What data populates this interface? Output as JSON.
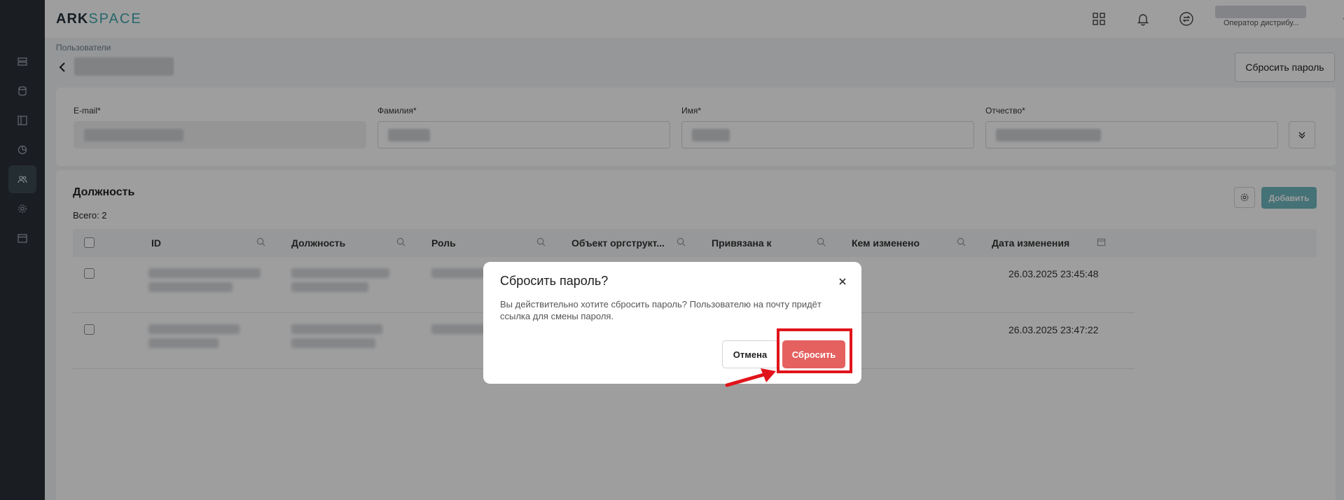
{
  "app": {
    "logo_part1": "ARK",
    "logo_part2": "SPACE"
  },
  "header": {
    "user_role": "Оператор дистрибу..."
  },
  "breadcrumb": "Пользователи",
  "page": {
    "reset_password_button": "Сбросить пароль"
  },
  "fields": {
    "email_label": "E-mail*",
    "lastname_label": "Фамилия*",
    "firstname_label": "Имя*",
    "middlename_label": "Отчество*"
  },
  "positions": {
    "title": "Должность",
    "total": "Всего: 2",
    "add_button": "Добавить",
    "columns": [
      "ID",
      "Должность",
      "Роль",
      "Объект оргструкт...",
      "Привязана к",
      "Кем изменено",
      "Дата изменения"
    ],
    "rows": [
      {
        "changed_at": "26.03.2025 23:45:48"
      },
      {
        "changed_at": "26.03.2025 23:47:22"
      }
    ]
  },
  "modal": {
    "title": "Сбросить пароль?",
    "message": "Вы действительно хотите сбросить пароль? Пользователю на почту придёт ссылка для смены пароля.",
    "cancel_label": "Отмена",
    "confirm_label": "Сбросить"
  },
  "colors": {
    "accent": "#3fa7ae",
    "danger": "#e46160",
    "annotation": "#e1141b",
    "sidebar": "#2b2f38"
  }
}
